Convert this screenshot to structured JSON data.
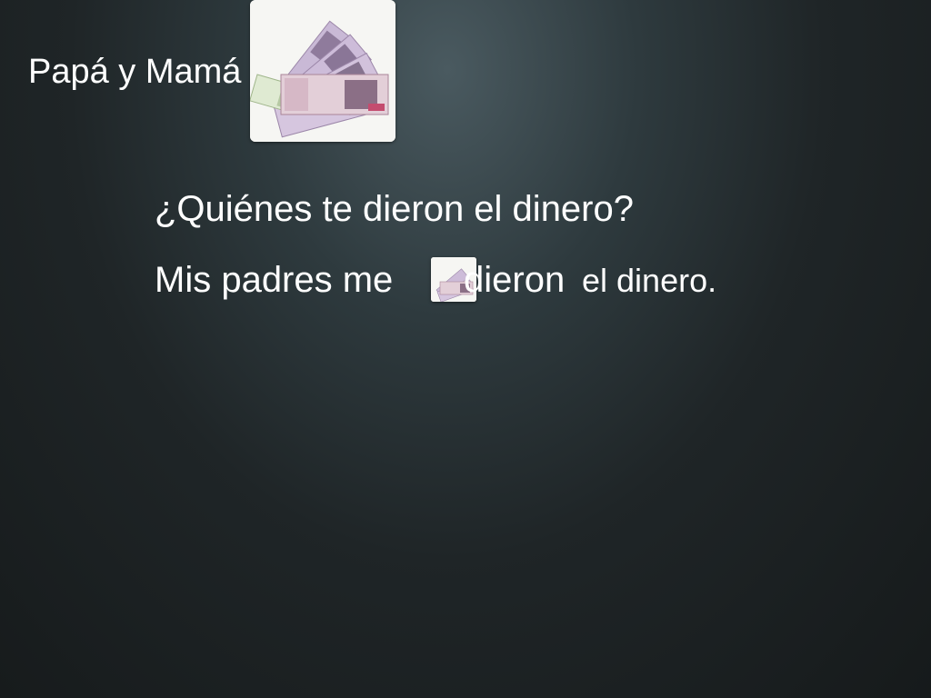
{
  "slide": {
    "label": "Papá y Mamá",
    "question": "¿Quiénes te dieron el dinero?",
    "answer": {
      "prefix": "Mis padres me",
      "verb": "dieron",
      "suffix": "el dinero."
    },
    "images": {
      "banknotes": "banknotes-icon"
    }
  }
}
